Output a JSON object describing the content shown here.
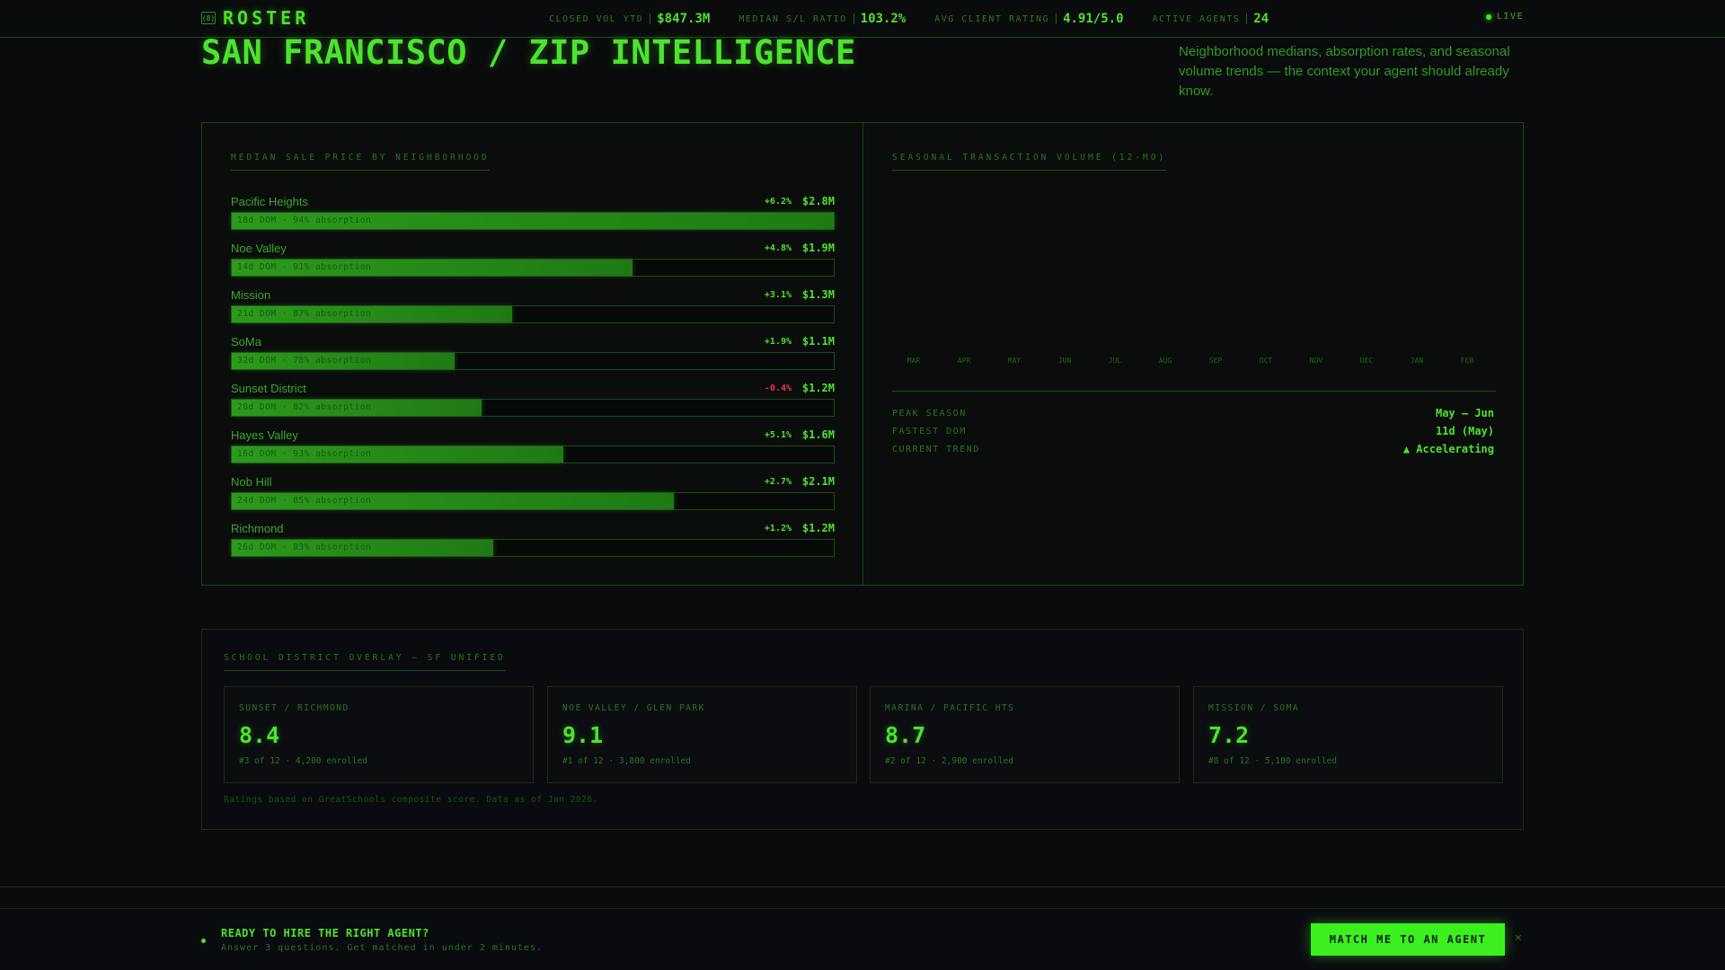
{
  "brand": {
    "logo_icon": "(8)",
    "name": "ROSTER"
  },
  "stats": [
    {
      "label": "CLOSED VOL YTD",
      "value": "$847.3M"
    },
    {
      "label": "MEDIAN S/L RATIO",
      "value": "103.2%"
    },
    {
      "label": "AVG CLIENT RATING",
      "value": "4.91/5.0"
    },
    {
      "label": "ACTIVE AGENTS",
      "value": "24"
    }
  ],
  "live_label": "LIVE",
  "header": {
    "title": "SAN FRANCISCO / ZIP INTELLIGENCE",
    "subtitle": "Neighborhood medians, absorption rates, and seasonal volume trends — the context your agent should already know."
  },
  "median_price": {
    "label": "MEDIAN SALE PRICE BY NEIGHBORHOOD",
    "rows": [
      {
        "name": "Pacific Heights",
        "change": "+6.2%",
        "negative": false,
        "price": "$2.8M",
        "level": 1.0,
        "note": "18d DOM · 94% absorption"
      },
      {
        "name": "Noe Valley",
        "change": "+4.8%",
        "negative": false,
        "price": "$1.9M",
        "level": 0.665,
        "note": "14d DOM · 91% absorption"
      },
      {
        "name": "Mission",
        "change": "+3.1%",
        "negative": false,
        "price": "$1.3M",
        "level": 0.465,
        "note": "21d DOM · 87% absorption"
      },
      {
        "name": "SoMa",
        "change": "+1.9%",
        "negative": false,
        "price": "$1.1M",
        "level": 0.37,
        "note": "32d DOM · 78% absorption"
      },
      {
        "name": "Sunset District",
        "change": "-0.4%",
        "negative": true,
        "price": "$1.2M",
        "level": 0.415,
        "note": "28d DOM · 82% absorption"
      },
      {
        "name": "Hayes Valley",
        "change": "+5.1%",
        "negative": false,
        "price": "$1.6M",
        "level": 0.55,
        "note": "16d DOM · 93% absorption"
      },
      {
        "name": "Nob Hill",
        "change": "+2.7%",
        "negative": false,
        "price": "$2.1M",
        "level": 0.735,
        "note": "24d DOM · 85% absorption"
      },
      {
        "name": "Richmond",
        "change": "+1.2%",
        "negative": false,
        "price": "$1.2M",
        "level": 0.435,
        "note": "26d DOM · 83% absorption"
      }
    ]
  },
  "seasonal": {
    "label": "SEASONAL TRANSACTION VOLUME (12-MO)",
    "months": [
      "MAR",
      "APR",
      "MAY",
      "JUN",
      "JUL",
      "AUG",
      "SEP",
      "OCT",
      "NOV",
      "DEC",
      "JAN",
      "FEB"
    ],
    "summary": [
      {
        "label": "PEAK SEASON",
        "value": "May – Jun"
      },
      {
        "label": "FASTEST DOM",
        "value": "11d (May)"
      },
      {
        "label": "CURRENT TREND",
        "value": "▲ Accelerating"
      }
    ]
  },
  "schools": {
    "label": "SCHOOL DISTRICT OVERLAY — SF UNIFIED",
    "cards": [
      {
        "label": "SUNSET / RICHMOND",
        "score": "8.4",
        "meta": "#3 of 12 · 4,200 enrolled"
      },
      {
        "label": "NOE VALLEY / GLEN PARK",
        "score": "9.1",
        "meta": "#1 of 12 · 3,800 enrolled"
      },
      {
        "label": "MARINA / PACIFIC HTS",
        "score": "8.7",
        "meta": "#2 of 12 · 2,900 enrolled"
      },
      {
        "label": "MISSION / SOMA",
        "score": "7.2",
        "meta": "#8 of 12 · 5,100 enrolled"
      }
    ],
    "note": "Ratings based on GreatSchools composite score. Data as of Jan 2026."
  },
  "cta": {
    "title": "READY TO HIRE THE RIGHT AGENT?",
    "subtitle": "Answer 3 questions. Get matched in under 2 minutes.",
    "button": "MATCH ME TO AN AGENT",
    "close": "×"
  }
}
